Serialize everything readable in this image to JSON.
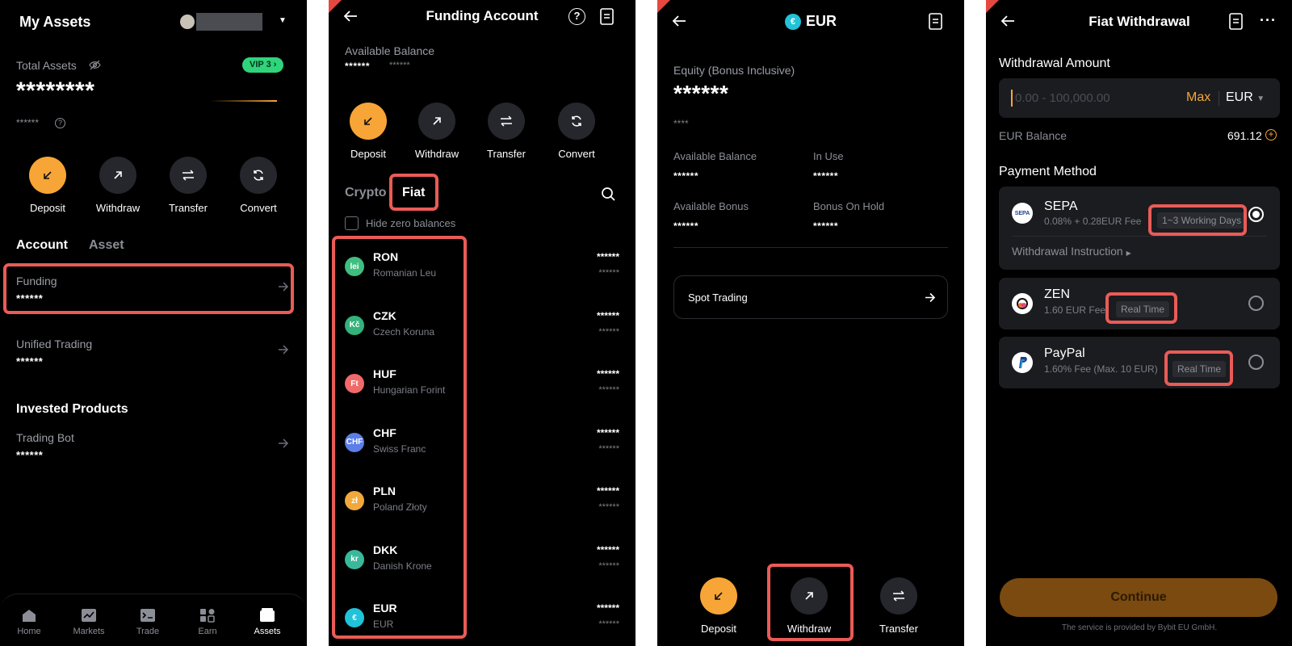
{
  "p1": {
    "title": "My Assets",
    "total_assets_label": "Total Assets",
    "vip_badge": "VIP 3",
    "total_value": "********",
    "sub_value": "******",
    "actions": [
      {
        "label": "Deposit",
        "icon": "arrow-down-left-icon"
      },
      {
        "label": "Withdraw",
        "icon": "arrow-up-right-icon"
      },
      {
        "label": "Transfer",
        "icon": "transfer-icon"
      },
      {
        "label": "Convert",
        "icon": "convert-icon"
      }
    ],
    "tabs": [
      "Account",
      "Asset"
    ],
    "rows": [
      {
        "title": "Funding",
        "value": "******"
      },
      {
        "title": "Unified Trading",
        "value": "******"
      }
    ],
    "invested_heading": "Invested Products",
    "bot_row": {
      "title": "Trading Bot",
      "value": "******"
    },
    "nav": [
      "Home",
      "Markets",
      "Trade",
      "Earn",
      "Assets"
    ]
  },
  "p2": {
    "title": "Funding Account",
    "available_label": "Available Balance",
    "available_value": "******",
    "available_sub": "******",
    "actions": [
      {
        "label": "Deposit"
      },
      {
        "label": "Withdraw"
      },
      {
        "label": "Transfer"
      },
      {
        "label": "Convert"
      }
    ],
    "tab_crypto": "Crypto",
    "tab_fiat": "Fiat",
    "hide_zero": "Hide zero balances",
    "currencies": [
      {
        "symbol": "lei",
        "code": "RON",
        "name": "Romanian Leu",
        "color": "#3fbf7f",
        "v1": "******",
        "v2": "******"
      },
      {
        "symbol": "Kč",
        "code": "CZK",
        "name": "Czech Koruna",
        "color": "#33b27a",
        "v1": "******",
        "v2": "******"
      },
      {
        "symbol": "Ft",
        "code": "HUF",
        "name": "Hungarian Forint",
        "color": "#f06a6a",
        "v1": "******",
        "v2": "******"
      },
      {
        "symbol": "CHF",
        "code": "CHF",
        "name": "Swiss Franc",
        "color": "#5b7ee8",
        "v1": "******",
        "v2": "******"
      },
      {
        "symbol": "zł",
        "code": "PLN",
        "name": "Poland Złoty",
        "color": "#f2a93b",
        "v1": "******",
        "v2": "******"
      },
      {
        "symbol": "kr",
        "code": "DKK",
        "name": "Danish Krone",
        "color": "#3bb89a",
        "v1": "******",
        "v2": "******"
      },
      {
        "symbol": "€",
        "code": "EUR",
        "name": "EUR",
        "color": "#21c3d9",
        "v1": "******",
        "v2": "******"
      }
    ]
  },
  "p3": {
    "title": "EUR",
    "equity_label": "Equity (Bonus Inclusive)",
    "equity_value": "******",
    "equity_sub": "****",
    "grid": [
      {
        "label": "Available Balance",
        "value": "******"
      },
      {
        "label": "In Use",
        "value": "******"
      },
      {
        "label": "Available Bonus",
        "value": "******"
      },
      {
        "label": "Bonus On Hold",
        "value": "******"
      }
    ],
    "spot_trading": "Spot Trading",
    "actions": [
      {
        "label": "Deposit"
      },
      {
        "label": "Withdraw"
      },
      {
        "label": "Transfer"
      }
    ]
  },
  "p4": {
    "title": "Fiat Withdrawal",
    "amount_label": "Withdrawal Amount",
    "amount_placeholder": "0.00 - 100,000.00",
    "max_label": "Max",
    "currency": "EUR",
    "balance_label": "EUR Balance",
    "balance_value": "691.12",
    "payment_label": "Payment Method",
    "methods": [
      {
        "name": "SEPA",
        "fee": "0.08% + 0.28EUR Fee",
        "badge": "1~3 Working Days",
        "instruction": "Withdrawal Instruction"
      },
      {
        "name": "ZEN",
        "fee": "1.60 EUR Fee",
        "badge": "Real Time"
      },
      {
        "name": "PayPal",
        "fee": "1.60%  Fee (Max. 10 EUR)",
        "badge": "Real Time"
      }
    ],
    "continue": "Continue",
    "footer": "The service is provided by Bybit EU GmbH."
  }
}
